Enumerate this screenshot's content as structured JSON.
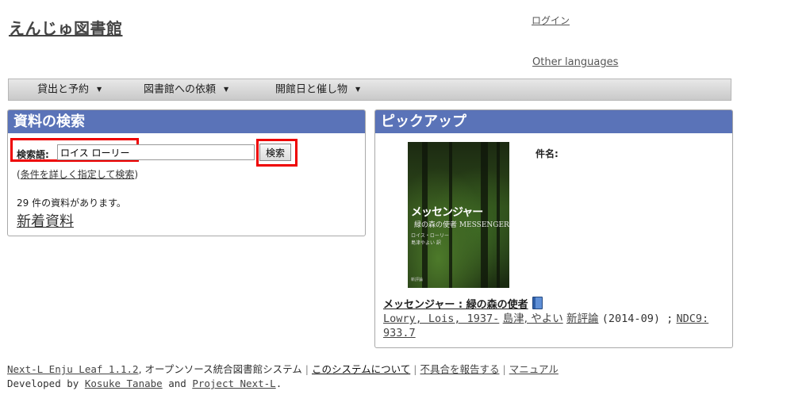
{
  "site": {
    "title": "えんじゅ図書館"
  },
  "header": {
    "login_link": "ログイン",
    "other_languages": "Other languages"
  },
  "menu": [
    {
      "label": "貸出と予約"
    },
    {
      "label": "図書館への依頼"
    },
    {
      "label": "開館日と催し物"
    }
  ],
  "search": {
    "heading": "資料の検索",
    "label": "検索語:",
    "query": "ロイス ローリー",
    "button": "検索",
    "adv_open": "(",
    "adv_link": "条件を詳しく指定して検索",
    "adv_close": ")",
    "count_text": "29 件の資料があります。",
    "new_items_link": "新着資料"
  },
  "pickup": {
    "heading": "ピックアップ",
    "subject_label": "件名:",
    "cover": {
      "title": "メッセンジャー",
      "subtitle": "緑の森の使者 MESSENGER",
      "author": "ロイス・ローリー",
      "translator": "島津やよい 訳",
      "publisher": "新評論"
    },
    "book_title": "メッセンジャー : 緑の森の使者",
    "author1": "Lowry, Lois, 1937-",
    "author2": "島津, やよい",
    "publisher": "新評論",
    "date": "(2014-09) ;",
    "ndc": "NDC9: 933.7"
  },
  "footer": {
    "product": "Next-L Enju Leaf 1.1.2",
    "product_suffix": ", オープンソース統合図書館システム",
    "about": "このシステムについて",
    "report": "不具合を報告する",
    "manual": "マニュアル",
    "dev_prefix": "Developed by",
    "dev1": "Kosuke Tanabe",
    "and": "and",
    "dev2": "Project Next-L",
    "period": "."
  }
}
